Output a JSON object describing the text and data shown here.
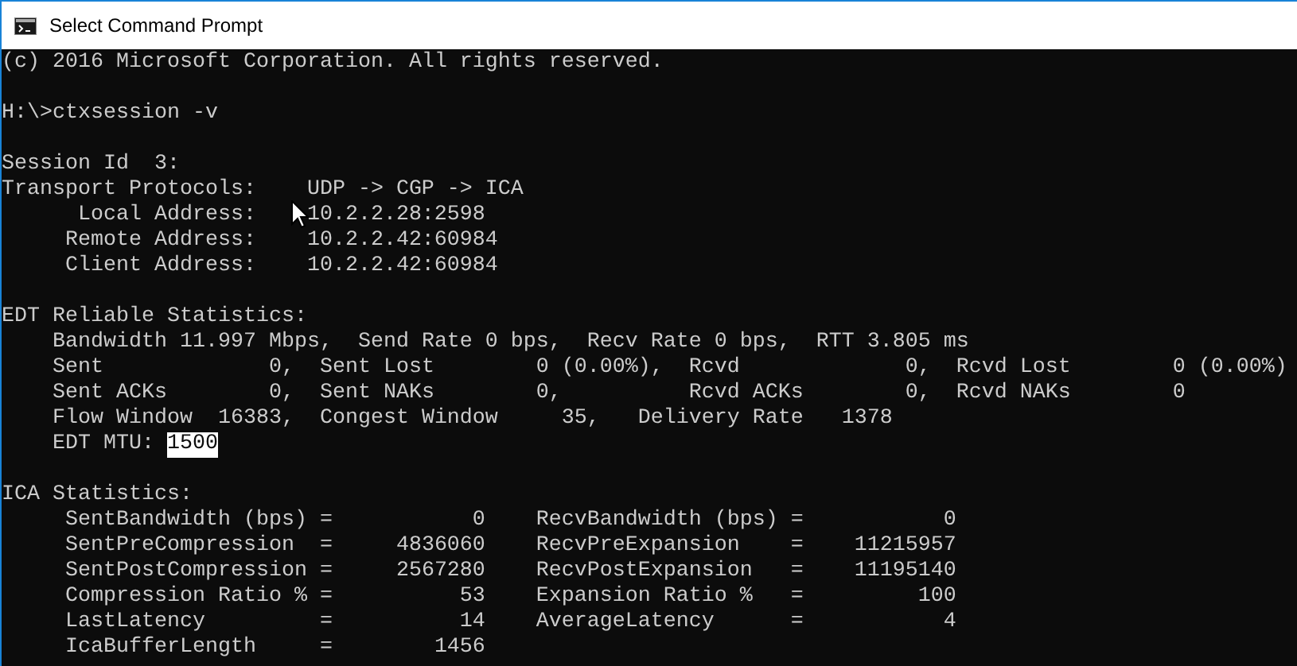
{
  "window": {
    "title": "Select Command Prompt"
  },
  "console": {
    "blocks": [
      {
        "lines": [
          {
            "text": "(c) 2016 Microsoft Corporation. All rights reserved."
          }
        ]
      },
      {
        "lines": [
          {
            "text": "H:\\>ctxsession -v"
          }
        ]
      },
      {
        "lines": [
          {
            "text": "Session Id  3:"
          },
          {
            "text": "Transport Protocols:",
            "value": "UDP -> CGP -> ICA"
          },
          {
            "text": "      Local Address:",
            "value": "10.2.2.28:2598"
          },
          {
            "text": "     Remote Address:",
            "value": "10.2.2.42:60984"
          },
          {
            "text": "     Client Address:",
            "value": "10.2.2.42:60984"
          }
        ]
      },
      {
        "lines": [
          {
            "text": "EDT Reliable Statistics:"
          },
          {
            "text": "    Bandwidth 11.997 Mbps,  Send Rate 0 bps,  Recv Rate 0 bps,  RTT 3.805 ms"
          },
          {
            "text": "    Sent             0,  Sent Lost        0 (0.00%),  Rcvd             0,  Rcvd Lost        0 (0.00%)"
          },
          {
            "text": "    Sent ACKs        0,  Sent NAKs        0,          Rcvd ACKs        0,  Rcvd NAKs        0"
          },
          {
            "text": "    Flow Window  16383,  Congest Window     35,   Delivery Rate   1378"
          },
          {
            "text": "    EDT MTU: ",
            "selection": "1500"
          }
        ]
      },
      {
        "lines": [
          {
            "text": "ICA Statistics:"
          },
          {
            "text": "     SentBandwidth (bps) =           0    RecvBandwidth (bps) =           0"
          },
          {
            "text": "     SentPreCompression  =     4836060    RecvPreExpansion    =    11215957"
          },
          {
            "text": "     SentPostCompression =     2567280    RecvPostExpansion   =    11195140"
          },
          {
            "text": "     Compression Ratio % =          53    Expansion Ratio %   =         100"
          },
          {
            "text": "     LastLatency         =          14    AverageLatency      =           4"
          },
          {
            "text": "     IcaBufferLength     =        1456"
          }
        ]
      }
    ]
  }
}
